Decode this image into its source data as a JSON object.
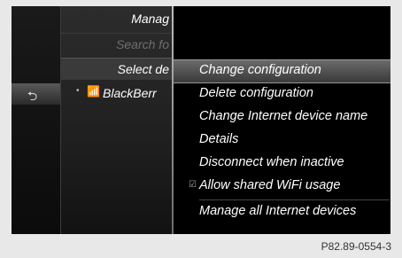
{
  "main_panel": {
    "title": "Manag",
    "search_placeholder": "Search fo",
    "select_label": "Select de",
    "device": {
      "name": "BlackBerr",
      "icon": "phone-signal-icon"
    }
  },
  "back_button": {
    "icon": "back-arrow-icon"
  },
  "menu": {
    "items": [
      {
        "label": "Change configuration",
        "selected": true
      },
      {
        "label": "Delete configuration"
      },
      {
        "label": "Change Internet device name"
      },
      {
        "label": "Details"
      },
      {
        "label": "Disconnect when inactive"
      },
      {
        "label": "Allow shared WiFi usage",
        "checkbox": true,
        "checked": true
      },
      {
        "label": "Manage all Internet devices"
      }
    ]
  },
  "caption": "P82.89-0554-3"
}
